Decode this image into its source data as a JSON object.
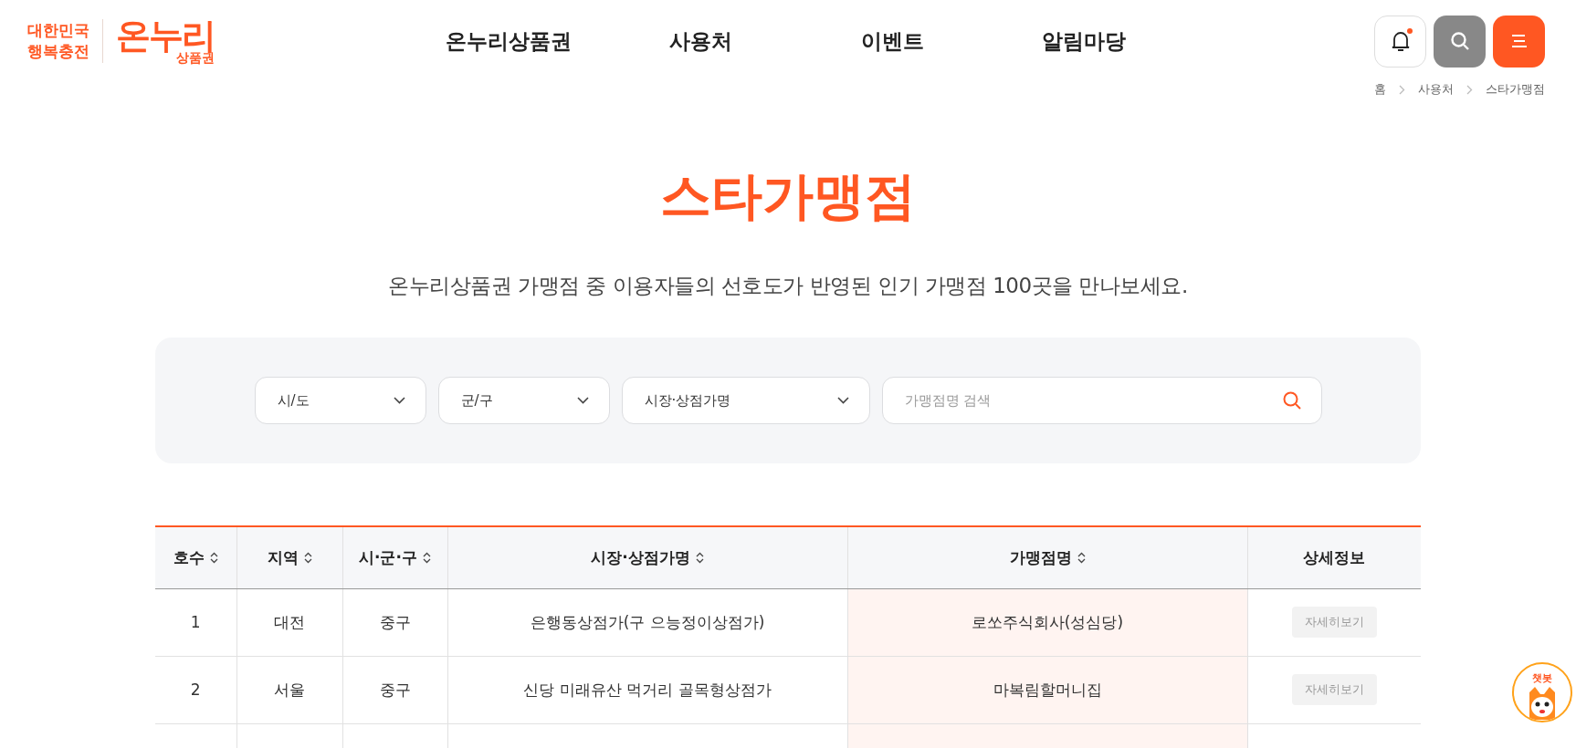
{
  "logo": {
    "slogan_top": "대한민국",
    "slogan_bottom": "행복충전",
    "brand": "온누리",
    "brand_sub": "상품권"
  },
  "nav": [
    "온누리상품권",
    "사용처",
    "이벤트",
    "알림마당"
  ],
  "header_actions": {
    "notification_unread": true
  },
  "breadcrumb": [
    "홈",
    "사용처",
    "스타가맹점"
  ],
  "page_title": "스타가맹점",
  "page_subtitle": "온누리상품권 가맹점 중 이용자들의 선호도가 반영된 인기 가맹점 100곳을 만나보세요.",
  "filters": {
    "selects": [
      "시/도",
      "군/구",
      "시장·상점가명"
    ],
    "search": {
      "placeholder": "가맹점명 검색"
    }
  },
  "table": {
    "columns": [
      {
        "label": "호수",
        "sortable": true,
        "highlighted": false
      },
      {
        "label": "지역",
        "sortable": true,
        "highlighted": false
      },
      {
        "label": "시·군·구",
        "sortable": true,
        "highlighted": false
      },
      {
        "label": "시장·상점가명",
        "sortable": true,
        "highlighted": false
      },
      {
        "label": "가맹점명",
        "sortable": true,
        "highlighted": true
      },
      {
        "label": "상세정보",
        "sortable": false,
        "highlighted": false
      }
    ],
    "rows": [
      {
        "cells": [
          "1",
          "대전",
          "중구",
          "은행동상점가(구 으능정이상점가)",
          "로쏘주식회사(성심당)"
        ],
        "button": "자세히보기"
      },
      {
        "cells": [
          "2",
          "서울",
          "중구",
          "신당 미래유산 먹거리 골목형상점가",
          "마복림할머니집"
        ],
        "button": "자세히보기"
      },
      {
        "cells": []
      }
    ]
  },
  "chatbot": {
    "label": "챗봇"
  }
}
